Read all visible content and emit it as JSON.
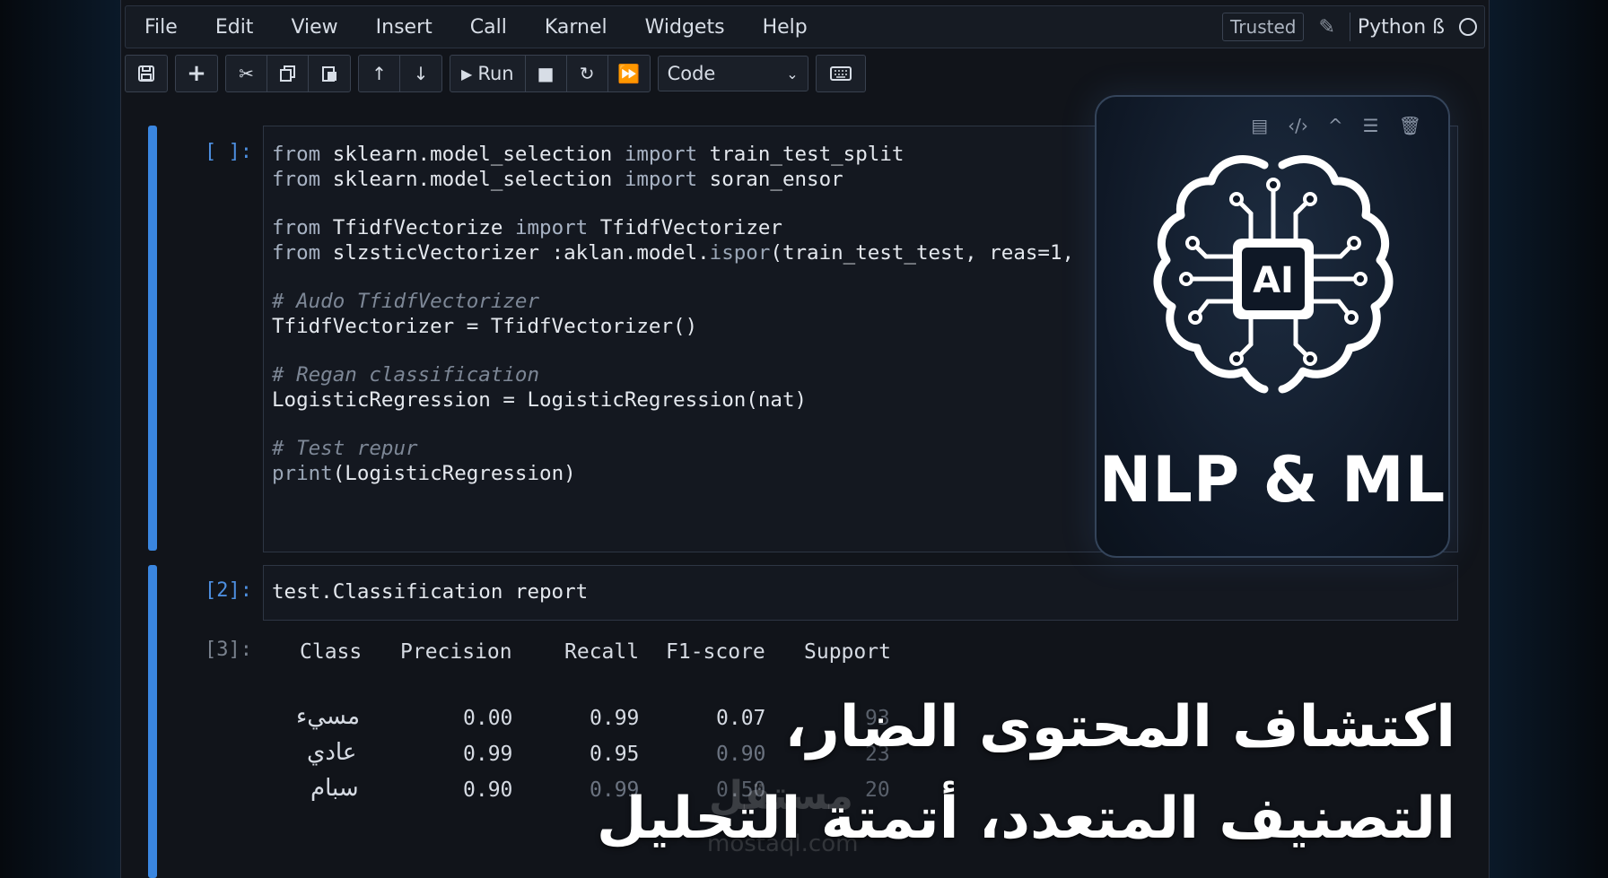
{
  "menu": {
    "items": [
      "File",
      "Edit",
      "View",
      "Insert",
      "Call",
      "Karnel",
      "Widgets",
      "Help"
    ],
    "trusted": "Trusted",
    "kernel": "Python ß"
  },
  "toolbar": {
    "run_label": "Run",
    "cell_type": "Code"
  },
  "cells": {
    "cell1": {
      "prompt": "[ ]:",
      "lines": [
        {
          "parts": [
            [
              "kw",
              "from"
            ],
            [
              "t",
              " sklearn.model_selection "
            ],
            [
              "kw",
              "import"
            ],
            [
              "t",
              " train_test_split"
            ]
          ]
        },
        {
          "parts": [
            [
              "kw",
              "from"
            ],
            [
              "t",
              " sklearn.model_selection "
            ],
            [
              "kw",
              "import"
            ],
            [
              "t",
              " soran_ensor"
            ]
          ]
        },
        {
          "parts": []
        },
        {
          "parts": [
            [
              "kw",
              "from"
            ],
            [
              "t",
              " TfidfVectorize "
            ],
            [
              "kw",
              "import"
            ],
            [
              "t",
              " TfidfVectorizer"
            ]
          ]
        },
        {
          "parts": [
            [
              "kw",
              "from"
            ],
            [
              "t",
              " slzsticVectorizer :aklan.model."
            ],
            [
              "fn",
              "ispor"
            ],
            [
              "t",
              "(train_test_test, reas=1,"
            ]
          ]
        },
        {
          "parts": []
        },
        {
          "parts": [
            [
              "cm",
              "# Audo TfidfVectorizer"
            ]
          ]
        },
        {
          "parts": [
            [
              "t",
              "TfidfVectorizer = TfidfVectorizer()"
            ]
          ]
        },
        {
          "parts": []
        },
        {
          "parts": [
            [
              "cm",
              "# Regan classification"
            ]
          ]
        },
        {
          "parts": [
            [
              "t",
              "LogisticRegression = LogisticRegression(nat)"
            ]
          ]
        },
        {
          "parts": []
        },
        {
          "parts": [
            [
              "cm",
              "# Test repur"
            ]
          ]
        },
        {
          "parts": [
            [
              "fn",
              "print"
            ],
            [
              "t",
              "(LogisticRegression)"
            ]
          ]
        }
      ]
    },
    "cell2": {
      "prompt": "[2]:",
      "code": "test.Classification report"
    },
    "cell3": {
      "prompt": "[3]:",
      "headers": [
        "Class",
        "Precision",
        "Recall",
        "F1-score",
        "Support"
      ],
      "rows": [
        {
          "class": "مسيء",
          "precision": "0.00",
          "recall": "0.99",
          "f1": "0.07",
          "support": "93"
        },
        {
          "class": "عادي",
          "precision": "0.99",
          "recall": "0.95",
          "f1": "0.90",
          "support": "23"
        },
        {
          "class": "سبام",
          "precision": "0.90",
          "recall": "0.99",
          "f1": "0.50",
          "support": "20"
        }
      ]
    }
  },
  "card": {
    "badge": "AI",
    "title": "NLP & ML"
  },
  "caption": {
    "line1": "اكتشاف المحتوى الضار،",
    "line2": "التصنيف المتعدد، أتمتة التحليل"
  },
  "watermark": {
    "brand": "مستقل",
    "url": "mostaql.com"
  }
}
